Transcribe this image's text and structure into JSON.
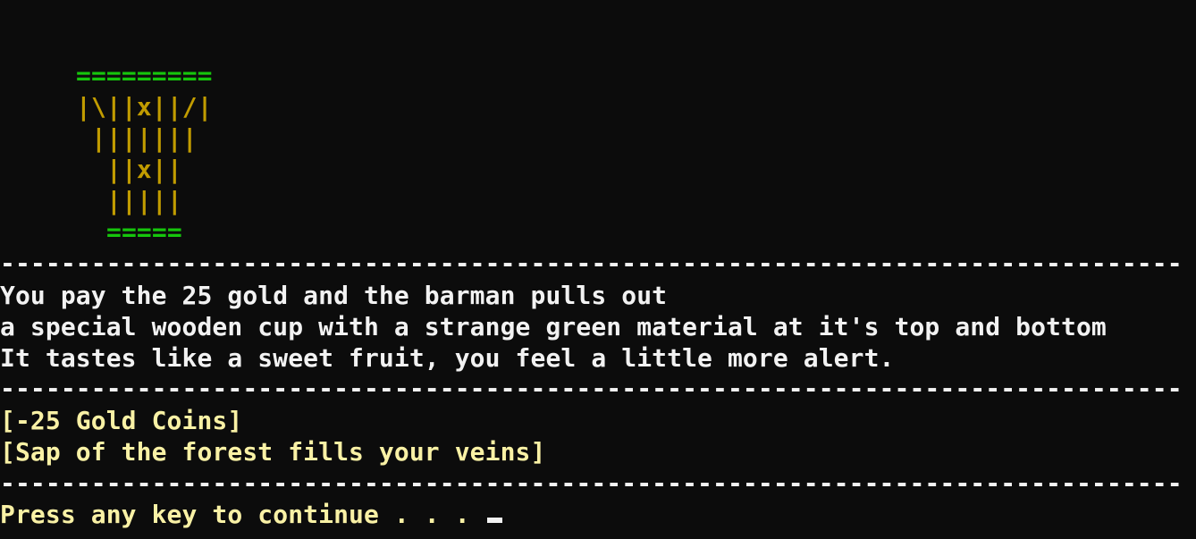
{
  "art": {
    "top_rim": "=========",
    "row1": "|\\||x||/|",
    "row2": "|||||||",
    "row3": "||x||",
    "row4": "|||||",
    "bottom_rim": "====="
  },
  "separator": "------------------------------------------------------------------------------",
  "narration": [
    "You pay the 25 gold and the barman pulls out",
    "a special wooden cup with a strange green material at it's top and bottom",
    "It tastes like a sweet fruit, you feel a little more alert."
  ],
  "effects": [
    "[-25 Gold Coins]",
    "[Sap of the forest fills your veins]"
  ],
  "prompt": "Press any key to continue . . . ",
  "colors": {
    "background": "#0c0c0c",
    "rim": "#16c60c",
    "cup": "#c19c00",
    "narration": "#f2f2f2",
    "effects": "#f9f1a5"
  }
}
